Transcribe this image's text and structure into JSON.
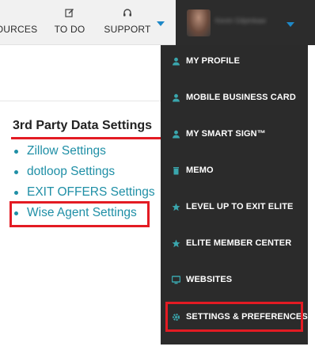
{
  "topnav": {
    "resources_label": "OURCES",
    "todo_label": "TO DO",
    "support_label": "SUPPORT",
    "todo_icon": "edit-icon",
    "support_icon": "headset-icon"
  },
  "user": {
    "name": "Kevin Gilpinkaw"
  },
  "content": {
    "section_title": "3rd Party Data Settings",
    "settings": [
      "Zillow Settings",
      "dotloop Settings",
      "EXIT OFFERS Settings",
      "Wise Agent Settings"
    ]
  },
  "menu": {
    "items": [
      {
        "label": "MY PROFILE",
        "icon": "user-icon"
      },
      {
        "label": "MOBILE BUSINESS CARD",
        "icon": "user-icon"
      },
      {
        "label": "MY SMART SIGN™",
        "icon": "user-icon"
      },
      {
        "label": "MEMO",
        "icon": "trash-icon"
      },
      {
        "label": "LEVEL UP TO EXIT ELITE",
        "icon": "star-icon"
      },
      {
        "label": "ELITE MEMBER CENTER",
        "icon": "star-icon"
      },
      {
        "label": "WEBSITES",
        "icon": "monitor-icon"
      },
      {
        "label": "SETTINGS & PREFERENCES",
        "icon": "gear-icon"
      }
    ]
  },
  "colors": {
    "accent": "#1e88c7",
    "link": "#1f8fa6",
    "highlight": "#e31b23",
    "menu_bg": "#2b2b2b",
    "menu_icon": "#3aa6ad"
  }
}
